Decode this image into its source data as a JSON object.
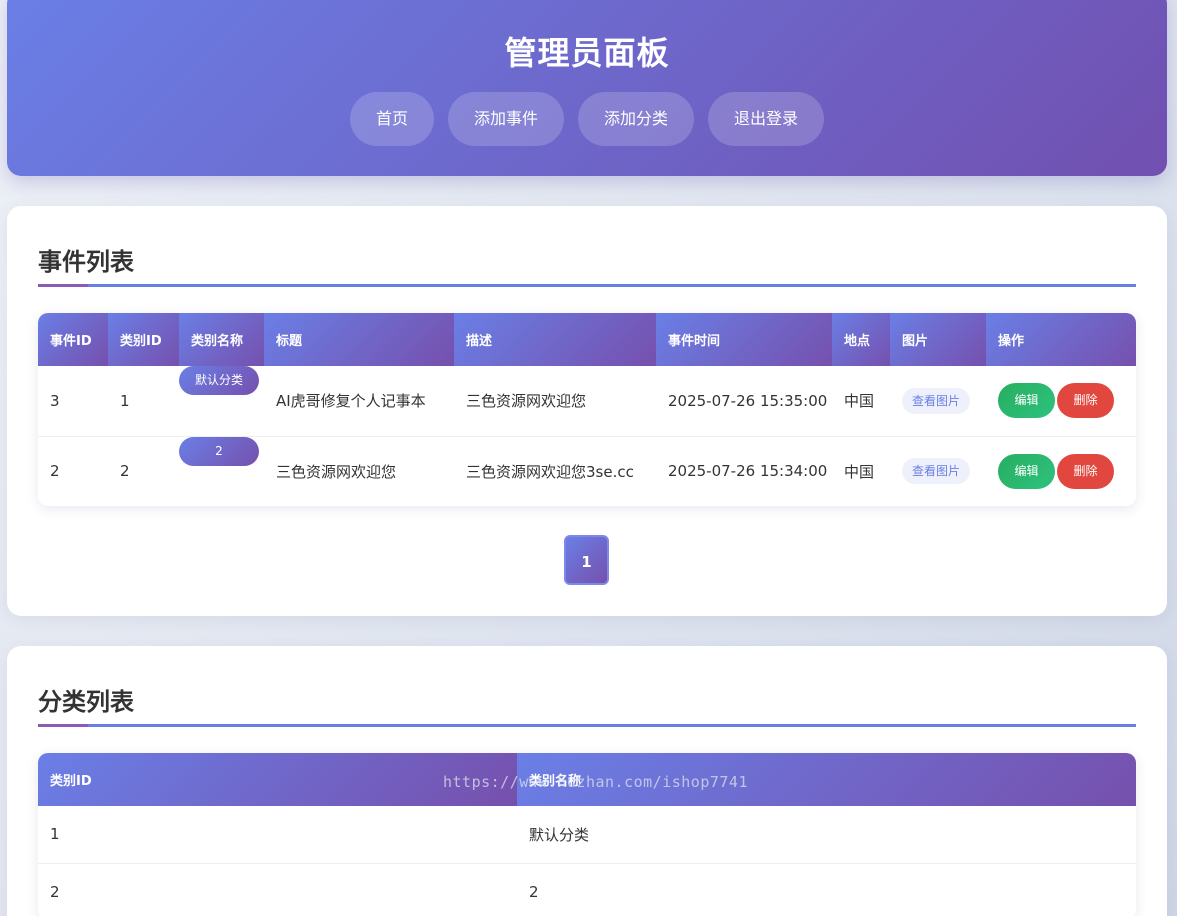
{
  "header": {
    "title": "管理员面板",
    "nav": [
      "首页",
      "添加事件",
      "添加分类",
      "退出登录"
    ]
  },
  "events": {
    "title": "事件列表",
    "columns": [
      "事件ID",
      "类别ID",
      "类别名称",
      "标题",
      "描述",
      "事件时间",
      "地点",
      "图片",
      "操作"
    ],
    "rows": [
      {
        "id": "3",
        "cat_id": "1",
        "cat_name": "默认分类",
        "title": "AI虎哥修复个人记事本",
        "desc": "三色资源网欢迎您",
        "time": "2025-07-26 15:35:00",
        "place": "中国",
        "img": "查看图片",
        "edit": "编辑",
        "del": "删除"
      },
      {
        "id": "2",
        "cat_id": "2",
        "cat_name": "2",
        "title": "三色资源网欢迎您",
        "desc": "三色资源网欢迎您3se.cc",
        "time": "2025-07-26 15:34:00",
        "place": "中国",
        "img": "查看图片",
        "edit": "编辑",
        "del": "删除"
      }
    ],
    "page": "1"
  },
  "categories": {
    "title": "分类列表",
    "columns": [
      "类别ID",
      "类别名称"
    ],
    "rows": [
      {
        "id": "1",
        "name": "默认分类"
      },
      {
        "id": "2",
        "name": "2"
      }
    ]
  },
  "watermark": "https://www.huzhan.com/ishop7741"
}
